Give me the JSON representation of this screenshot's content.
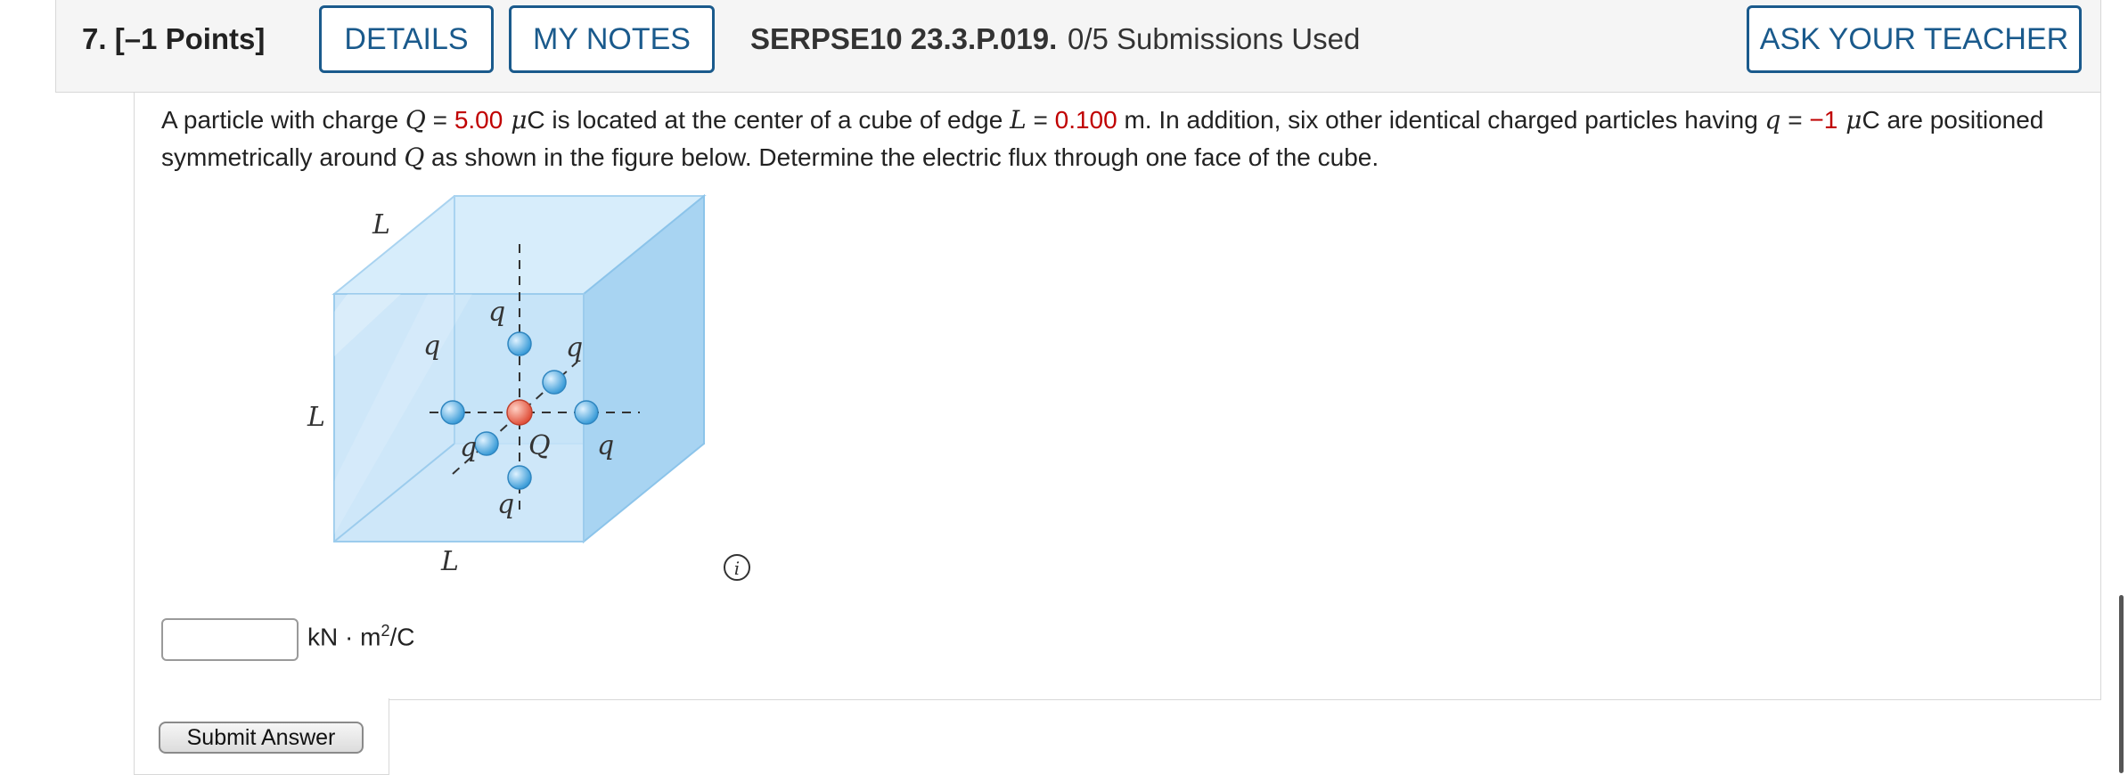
{
  "header": {
    "question_number": "7.",
    "points": "[–1 Points]",
    "details_label": "DETAILS",
    "notes_label": "MY NOTES",
    "code": "SERPSE10 23.3.P.019.",
    "submissions": "0/5 Submissions Used",
    "ask_label": "ASK YOUR TEACHER"
  },
  "problem": {
    "t1": "A particle with charge ",
    "Q_var": "Q",
    "eq1": " = ",
    "Q_val": "5.00",
    "Q_unit_mu": " μ",
    "Q_unit_C": "C is located at the center of a cube of edge ",
    "L_var": "L",
    "eq2": " = ",
    "L_val": "0.100",
    "t2": " m. In addition, six other identical charged particles having ",
    "q_var": "q",
    "eq3": " = ",
    "q_val": "−1",
    "q_unit_mu": " μ",
    "t3": "C are positioned symmetrically around ",
    "Q_var2": "Q",
    "t4": " as shown in the figure below. Determine the electric flux through one face of the cube."
  },
  "figure": {
    "label_L": "L",
    "label_q": "q",
    "label_Q": "Q",
    "center_color": "#e8604c",
    "charge_color": "#4aa8de",
    "cube_color": "#bfe0f6"
  },
  "answer": {
    "value": "",
    "unit_prefix": "kN · m",
    "unit_exp": "2",
    "unit_suffix": "/C"
  },
  "submit_label": "Submit Answer",
  "icons": {
    "info": "info-icon"
  }
}
